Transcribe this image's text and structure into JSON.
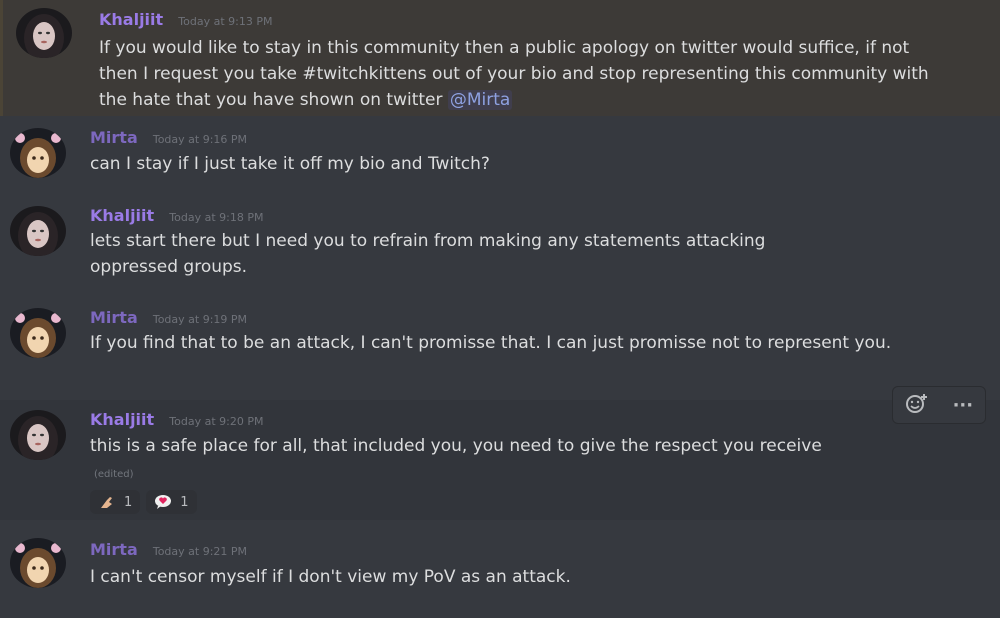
{
  "messages": [
    {
      "author": "Khaljiit",
      "timestamp": "Today at 9:13 PM",
      "text": "If you would like to stay in this community then a public apology on twitter would suffice, if not then I request you take #twitchkittens out of your bio and stop representing this community with the hate that you have shown on twitter",
      "mention": "@Mirta"
    },
    {
      "author": "Mirta",
      "timestamp": "Today at 9:16 PM",
      "text": "can I stay if I just take it off my bio and Twitch?"
    },
    {
      "author": "Khaljiit",
      "timestamp": "Today at 9:18 PM",
      "text": "lets start there but I need you to refrain from making any statements attacking oppressed groups."
    },
    {
      "author": "Mirta",
      "timestamp": "Today at 9:19 PM",
      "text": "If you find that to be an attack, I can't promisse that. I can just promisse not to represent you."
    },
    {
      "author": "Khaljiit",
      "timestamp": "Today at 9:20 PM",
      "text": "this is a safe place for all, that included you, you need to give the respect you receive",
      "edited": "(edited)",
      "reactions": [
        {
          "emoji": "muscle-emoji",
          "count": "1"
        },
        {
          "emoji": "speech-bubble-heart-emoji",
          "count": "1"
        }
      ]
    },
    {
      "author": "Mirta",
      "timestamp": "Today at 9:21 PM",
      "text": "I can't censor myself if I don't view my PoV as an attack."
    }
  ],
  "toolbar": {
    "add_reaction_icon": "add-reaction-icon",
    "more_icon": "more-options-icon",
    "more_glyph": "···"
  },
  "colors": {
    "background": "#36393f",
    "highlight": "#3d3a37",
    "username": "#8f6ed5",
    "mention": "#8ea1e1"
  }
}
